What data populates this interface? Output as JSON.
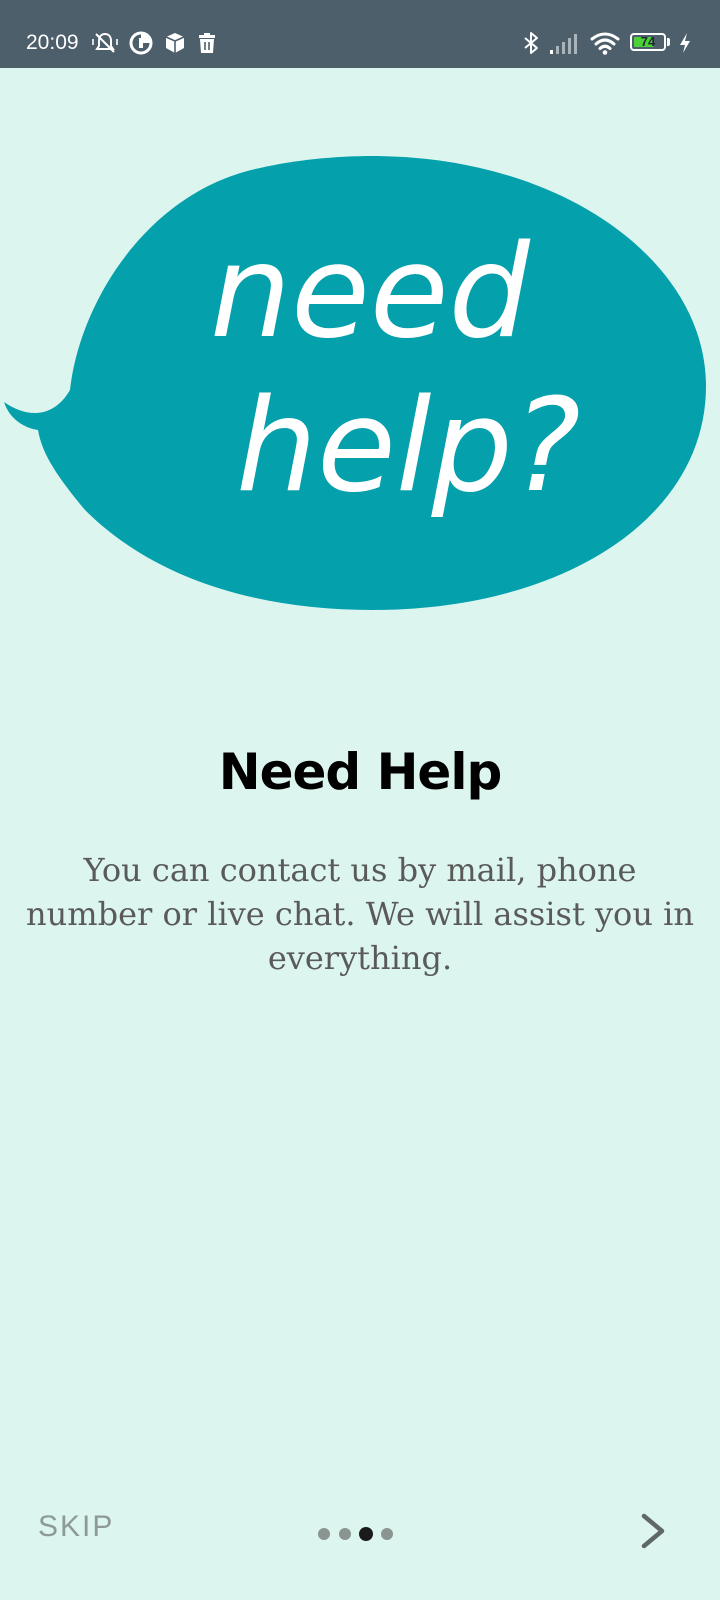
{
  "status_bar": {
    "time": "20:09",
    "battery_level": "74",
    "icons": [
      "mute-vibrate-icon",
      "data-saver-icon",
      "package-icon",
      "trash-icon",
      "bluetooth-icon",
      "signal-icon",
      "wifi-icon",
      "battery-icon",
      "charging-icon"
    ]
  },
  "hero": {
    "bubble_line1": "need",
    "bubble_line2": "help?",
    "bubble_color": "#04a0ab"
  },
  "content": {
    "title": "Need Help",
    "description": "You can contact us by mail, phone number or live chat. We will assist you in everything."
  },
  "navigation": {
    "skip_label": "SKIP",
    "page_count": 4,
    "current_page": 3,
    "next_icon": "chevron-right-icon"
  },
  "colors": {
    "background": "#dcf6ef",
    "status_bar": "#4c5f6b",
    "accent": "#04a0ab"
  }
}
